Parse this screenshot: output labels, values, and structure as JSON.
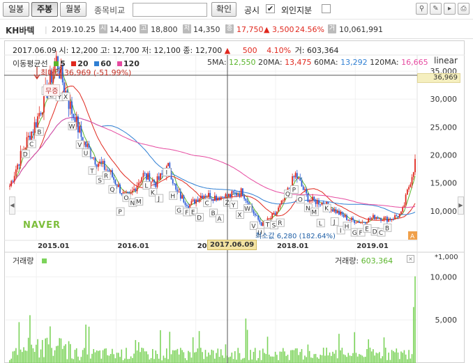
{
  "toolbar": {
    "periods": [
      {
        "label": "일봉",
        "active": false
      },
      {
        "label": "주봉",
        "active": true
      },
      {
        "label": "월봉",
        "active": false
      }
    ],
    "compare_label": "종목비교",
    "compare_value": "",
    "confirm_label": "확인",
    "disclosure_label": "공시",
    "disclosure_checked": "✔",
    "foreign_label": "외인지분",
    "foreign_checked": "",
    "tool_icons": [
      "pin-icon",
      "eraser-icon",
      "toggle-panel-icon",
      "print-icon"
    ]
  },
  "stock": {
    "name": "KH바텍",
    "date": "2019.10.25",
    "open_badge": "시",
    "open": "14,400",
    "high_badge": "고",
    "high": "18,800",
    "low_badge": "저",
    "low": "14,350",
    "close_badge": "종",
    "close": "17,750",
    "change": "▲ 3,500",
    "change_pct": "24.56%",
    "volume_badge": "거",
    "volume": "10,061,991"
  },
  "cursor": {
    "ohlc_text": "2017.06.09 시: 12,200  고: 12,700  저: 12,100  종: 12,700",
    "change_text": "▲",
    "change_value": "500",
    "change_pct": "4.10%",
    "volume_text": "거: 603,364",
    "date_label": "2017.06.09"
  },
  "ma": {
    "title": "이동평균선",
    "legend": [
      {
        "label": "5",
        "color": "#5bb52c"
      },
      {
        "label": "20",
        "color": "#e0281e"
      },
      {
        "label": "60",
        "color": "#2f7fd3"
      },
      {
        "label": "120",
        "color": "#e64aa0"
      }
    ],
    "values": [
      {
        "label": "5MA:",
        "value": "12,550",
        "color": "#5bb52c"
      },
      {
        "label": "20MA:",
        "value": "13,475",
        "color": "#e0281e"
      },
      {
        "label": "60MA:",
        "value": "13,292",
        "color": "#2f7fd3"
      },
      {
        "label": "120MA:",
        "value": "16,665",
        "color": "#e64aa0"
      }
    ]
  },
  "scale_label": "linear",
  "highlight_value": "36,969",
  "max_label": "최대값 36,969 (-51.99%)",
  "min_label": "최소값 6,280 (182.64%)",
  "event_label": "무증",
  "watermark": "NAVER",
  "volume_panel": {
    "title": "거래량",
    "reading_label": "거래량:",
    "reading_value": "603,364",
    "unit": "*1,000",
    "close_icon": "×"
  },
  "disclosure_markers": [
    "D",
    "C",
    "B",
    "A",
    "Z",
    "Y",
    "X",
    "W",
    "V",
    "U",
    "T",
    "S",
    "R",
    "Q",
    "P",
    "O",
    "N",
    "M",
    "L",
    "K",
    "J",
    "I",
    "H",
    "G",
    "F",
    "E",
    "D",
    "C",
    "B",
    "A",
    "Z",
    "Y",
    "X",
    "W",
    "V",
    "U",
    "T",
    "S",
    "R",
    "Q",
    "P",
    "O",
    "N",
    "M",
    "L",
    "K",
    "J",
    "I",
    "H",
    "G",
    "F",
    "E",
    "D",
    "C",
    "B",
    "A"
  ],
  "chart_data": {
    "type": "candlestick",
    "period": "weekly",
    "x_tick_labels": [
      "2015.01",
      "2016.01",
      "2017.01",
      "2018.01",
      "2019.01"
    ],
    "y_axis": {
      "min": 5000,
      "max": 37500,
      "ticks": [
        10000,
        15000,
        20000,
        25000,
        30000,
        35000
      ]
    },
    "max_point": {
      "date": "2015-04",
      "value": 36969
    },
    "min_point": {
      "date": "2017-11",
      "value": 6280
    },
    "price_path": [
      [
        "2014-09",
        14500
      ],
      [
        "2014-11",
        21000
      ],
      [
        "2015-01",
        26000
      ],
      [
        "2015-03",
        33000
      ],
      [
        "2015-04",
        36969
      ],
      [
        "2015-06",
        29000
      ],
      [
        "2015-08",
        22500
      ],
      [
        "2015-10",
        19000
      ],
      [
        "2015-12",
        17000
      ],
      [
        "2016-02",
        13000
      ],
      [
        "2016-03",
        12500
      ],
      [
        "2016-05",
        16500
      ],
      [
        "2016-07",
        15000
      ],
      [
        "2016-09",
        18000
      ],
      [
        "2016-10",
        13500
      ],
      [
        "2016-12",
        11000
      ],
      [
        "2017-02",
        13000
      ],
      [
        "2017-04",
        12500
      ],
      [
        "2017-06",
        12700
      ],
      [
        "2017-08",
        13500
      ],
      [
        "2017-10",
        9000
      ],
      [
        "2017-11",
        7500
      ],
      [
        "2018-01",
        9500
      ],
      [
        "2018-02",
        11500
      ],
      [
        "2018-04",
        16500
      ],
      [
        "2018-06",
        12000
      ],
      [
        "2018-08",
        11500
      ],
      [
        "2018-10",
        10000
      ],
      [
        "2018-12",
        8500
      ],
      [
        "2019-02",
        8000
      ],
      [
        "2019-04",
        9000
      ],
      [
        "2019-06",
        8500
      ],
      [
        "2019-08",
        9500
      ],
      [
        "2019-10",
        18800
      ]
    ],
    "ma_series": [
      {
        "name": "5",
        "color": "#5bb52c"
      },
      {
        "name": "20",
        "color": "#e0281e"
      },
      {
        "name": "60",
        "color": "#2f7fd3"
      },
      {
        "name": "120",
        "color": "#e64aa0"
      }
    ],
    "volume": {
      "ticks": [
        5000,
        10000
      ],
      "unit": "*1,000",
      "last_value": 10062
    }
  }
}
